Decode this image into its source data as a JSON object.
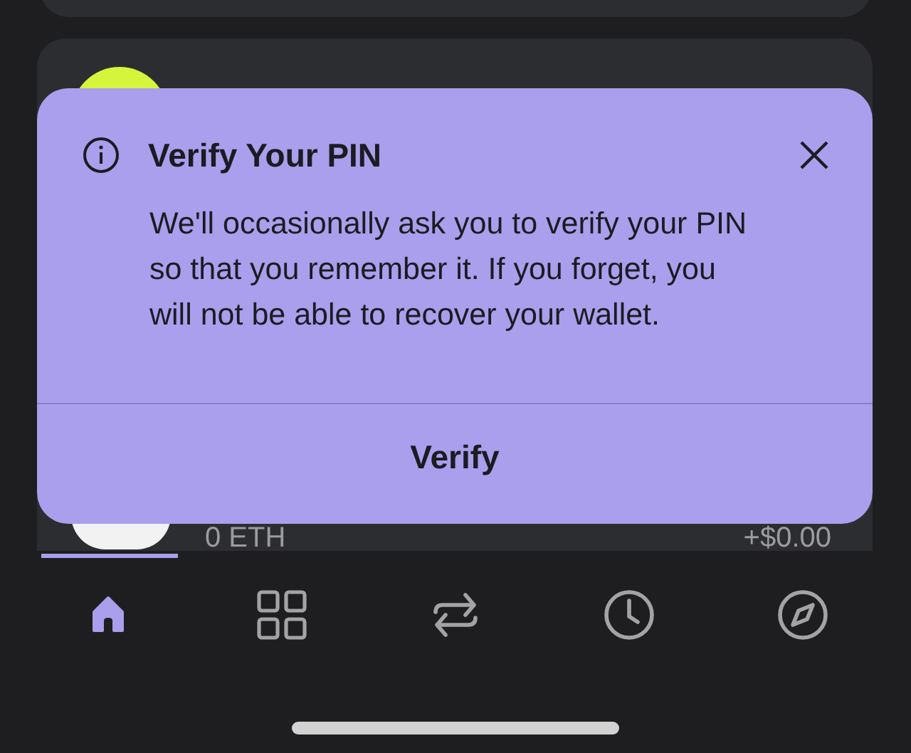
{
  "dialog": {
    "title": "Verify Your PIN",
    "message": "We'll occasionally ask you to verify your PIN so that you remember it. If you forget, you will not be able to recover your wallet.",
    "action": "Verify"
  },
  "asset_row": {
    "amount": "0 ETH",
    "change": "+$0.00"
  },
  "tabs": [
    {
      "kind": "home",
      "selected": true
    },
    {
      "kind": "grid",
      "selected": false
    },
    {
      "kind": "swap",
      "selected": false
    },
    {
      "kind": "history",
      "selected": false
    },
    {
      "kind": "explore",
      "selected": false
    }
  ]
}
